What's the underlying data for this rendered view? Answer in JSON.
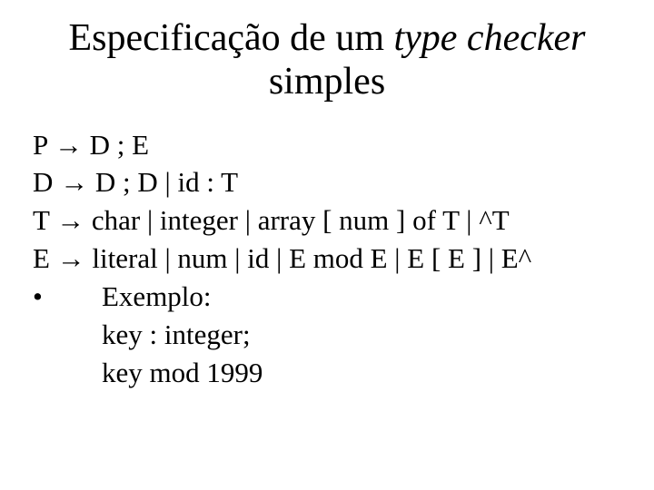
{
  "title": {
    "part1": "Especificação de um ",
    "italic": "type checker",
    "part2": "simples"
  },
  "grammar": {
    "line1": "P → D ; E",
    "line2": "D → D ; D | id : T",
    "line3": "T → char | integer | array [ num ] of T | ^T",
    "line4": "E → literal | num | id | E mod E | E [ E ] | E^"
  },
  "example": {
    "bullet": "•",
    "label": "Exemplo:",
    "line1": "key : integer;",
    "line2": "key mod 1999"
  }
}
